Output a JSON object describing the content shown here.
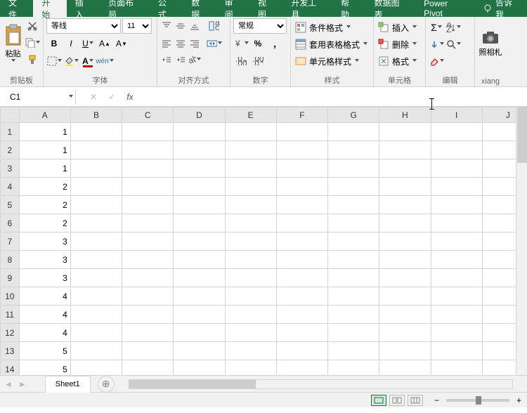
{
  "menu": {
    "tabs": [
      "文件",
      "开始",
      "插入",
      "页面布局",
      "公式",
      "数据",
      "审阅",
      "视图",
      "开发工具",
      "帮助",
      "数据图表",
      "Power Pivot"
    ],
    "active": 1,
    "tellme": "告诉我"
  },
  "ribbon": {
    "clipboard": {
      "label": "剪贴板",
      "paste": "粘贴"
    },
    "font": {
      "label": "字体",
      "name": "等线",
      "size": "11"
    },
    "align": {
      "label": "对齐方式"
    },
    "number": {
      "label": "数字",
      "format": "常规"
    },
    "styles": {
      "label": "样式",
      "cond": "条件格式",
      "table": "套用表格格式",
      "cell": "单元格样式"
    },
    "cells": {
      "label": "单元格",
      "insert": "插入",
      "delete": "删除",
      "format": "格式"
    },
    "edit": {
      "label": "编辑"
    },
    "camera": {
      "name": "照相机",
      "truncated": "照相札"
    }
  },
  "namebox": "C1",
  "formula": "",
  "columns": [
    "A",
    "B",
    "C",
    "D",
    "E",
    "F",
    "G",
    "H",
    "I",
    "J"
  ],
  "rows": [
    {
      "n": 1,
      "A": "1"
    },
    {
      "n": 2,
      "A": "1"
    },
    {
      "n": 3,
      "A": "1"
    },
    {
      "n": 4,
      "A": "2"
    },
    {
      "n": 5,
      "A": "2"
    },
    {
      "n": 6,
      "A": "2"
    },
    {
      "n": 7,
      "A": "3"
    },
    {
      "n": 8,
      "A": "3"
    },
    {
      "n": 9,
      "A": "3"
    },
    {
      "n": 10,
      "A": "4"
    },
    {
      "n": 11,
      "A": "4"
    },
    {
      "n": 12,
      "A": "4"
    },
    {
      "n": 13,
      "A": "5"
    },
    {
      "n": 14,
      "A": "5"
    }
  ],
  "sheet": "Sheet1"
}
